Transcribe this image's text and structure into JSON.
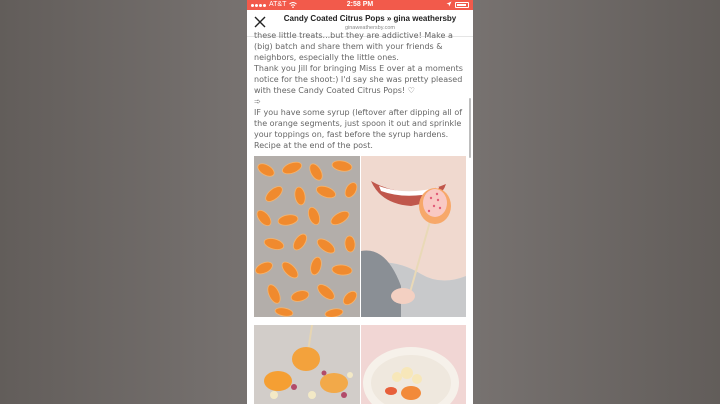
{
  "status_bar": {
    "carrier": "AT&T",
    "time": "2:58 PM"
  },
  "header": {
    "title": "Candy Coated Citrus Pops » gina weathersby",
    "url": "ginaweathersby.com"
  },
  "article": {
    "paragraphs": [
      "these little treats...but they are addictive! Make a (big) batch and share them with your friends & neighbors, especially the little ones.",
      "Thank you Jill for bringing Miss E over at a moments notice for the shoot:) I'd say she was pretty pleased with these Candy Coated Citrus Pops! ♡",
      "➾",
      "IF you have some syrup (leftover after dipping all of the orange segments, just spoon it out and sprinkle your toppings on, fast before the syrup hardens. Recipe at the end of the post."
    ]
  },
  "icons": {
    "close": "close-icon",
    "wifi": "wifi-icon",
    "location": "location-icon",
    "battery": "battery-icon"
  },
  "colors": {
    "status_bar": "#f25a4b",
    "background": "#6d6764"
  }
}
